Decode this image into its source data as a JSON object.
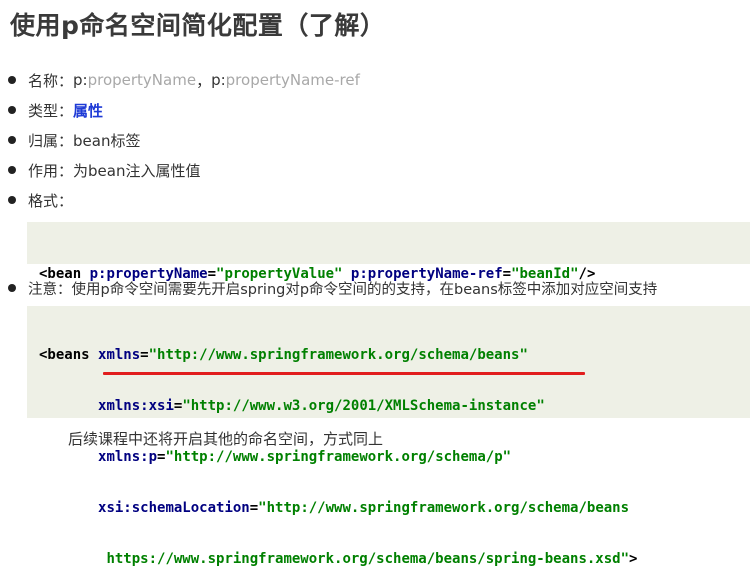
{
  "title": "使用p命名空间简化配置（了解）",
  "bullets": {
    "name": {
      "label": "名称：",
      "p1": "p:",
      "v1": "propertyName",
      "sep": "，",
      "p2": "p:",
      "v2": "propertyName-ref"
    },
    "type": {
      "label": "类型：",
      "value": "属性"
    },
    "belongs": {
      "label": "归属：",
      "value": "bean标签"
    },
    "usage": {
      "label": "作用：",
      "value": "为bean注入属性值"
    },
    "format": {
      "label": "格式："
    },
    "notice": {
      "text": "注意：使用p命令空间需要先开启spring对p命令空间的的支持，在beans标签中添加对应空间支持"
    }
  },
  "code1": {
    "open": "<bean",
    "attr1": "p:propertyName",
    "val1": "\"propertyValue\"",
    "attr2": "p:propertyName-ref",
    "val2": "\"beanId\"",
    "close": "/>"
  },
  "code2": {
    "open": "<beans",
    "a1": "xmlns",
    "v1": "\"http://www.springframework.org/schema/beans\"",
    "a2": "xmlns:xsi",
    "v2": "\"http://www.w3.org/2001/XMLSchema-instance\"",
    "a3": "xmlns:p",
    "v3": "\"http://www.springframework.org/schema/p\"",
    "a4": "xsi:schemaLocation",
    "v4": "\"http://www.springframework.org/schema/beans",
    "v5": "https://www.springframework.org/schema/beans/spring-beans.xsd\"",
    "close": ">"
  },
  "footnote": "后续课程中还将开启其他的命名空间，方式同上",
  "colors": {
    "highlight": "#1f3bd6",
    "underline": "#e11d1d",
    "code_bg": "#eef0e6"
  }
}
